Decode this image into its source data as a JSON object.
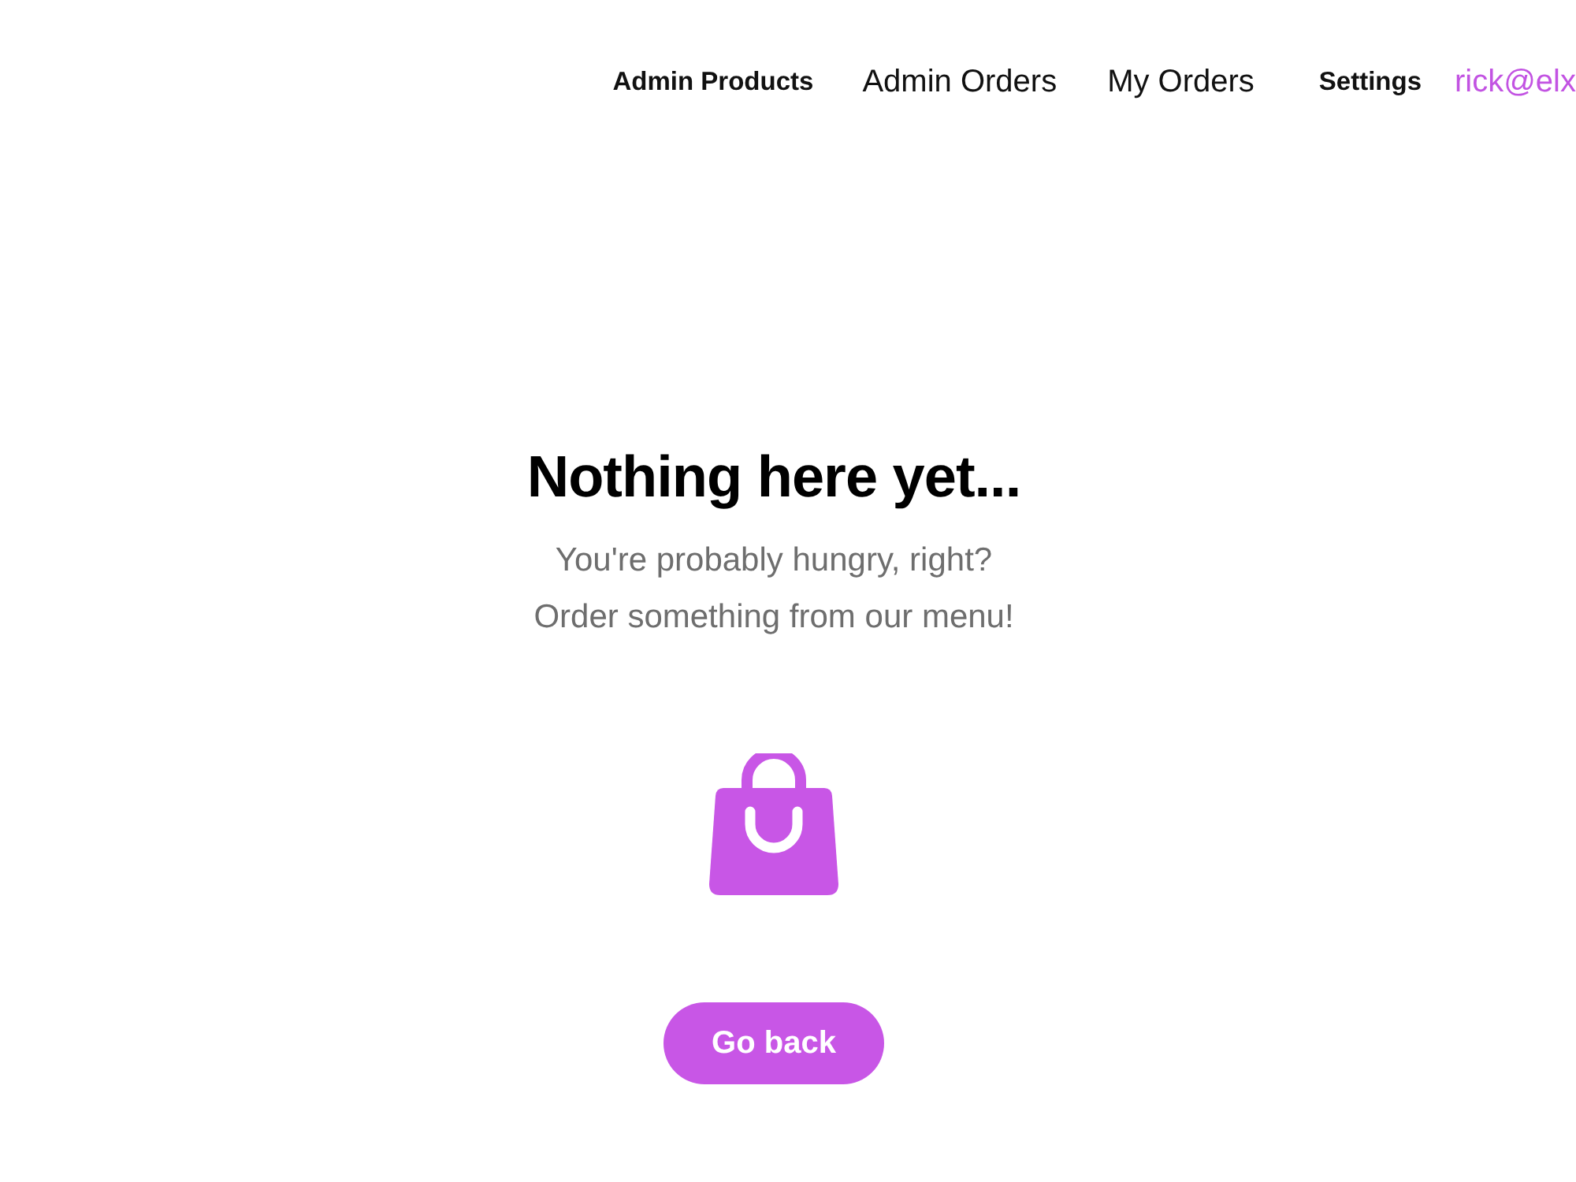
{
  "nav": {
    "links": [
      {
        "label": "Admin Products",
        "kind": "strong"
      },
      {
        "label": "Admin Orders",
        "kind": "plain"
      },
      {
        "label": "My Orders",
        "kind": "plain"
      },
      {
        "label": "Settings",
        "kind": "strong"
      }
    ],
    "user": "rick@elx"
  },
  "empty_state": {
    "title": "Nothing here yet...",
    "lines": [
      "You're probably hungry, right?",
      "Order something from our menu!"
    ],
    "button": "Go back"
  }
}
